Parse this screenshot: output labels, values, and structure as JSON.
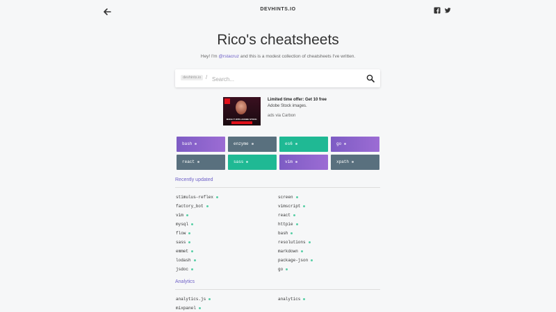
{
  "header": {
    "brand": "DEVHINTS.IO"
  },
  "hero": {
    "title": "Rico's cheatsheets",
    "intro_before": "Hey! I'm ",
    "intro_handle": "@rstacruz",
    "intro_after": " and this is a modest collection of cheatsheets I've written."
  },
  "search": {
    "site_chip": "devhints.io",
    "slash": "/",
    "placeholder": "Search..."
  },
  "ad": {
    "title": "Limited time offer: Get 10 free",
    "body": "Adobe Stock images.",
    "credit": "ads via Carbon",
    "image_caption": "MAKE IT WITH ADOBE STOCK."
  },
  "tiles": [
    {
      "label": "bash",
      "color": "purple"
    },
    {
      "label": "enzyme",
      "color": "slate"
    },
    {
      "label": "es6",
      "color": "teal"
    },
    {
      "label": "go",
      "color": "purple"
    },
    {
      "label": "react",
      "color": "slate"
    },
    {
      "label": "sass",
      "color": "teal"
    },
    {
      "label": "vim",
      "color": "purple"
    },
    {
      "label": "xpath",
      "color": "slate"
    }
  ],
  "recently_updated": {
    "heading": "Recently updated",
    "left": [
      "stimulus-reflex",
      "factory_bot",
      "vim",
      "mysql",
      "flow",
      "sass",
      "emmet",
      "lodash",
      "jsdoc"
    ],
    "right": [
      "screen",
      "vimscript",
      "react",
      "httpie",
      "bash",
      "resolutions",
      "markdown",
      "package-json",
      "go"
    ]
  },
  "analytics": {
    "heading": "Analytics",
    "left": [
      "analytics.js",
      "mixpanel"
    ],
    "right": [
      "analytics"
    ]
  },
  "colors": {
    "accent": "#6d5fc7",
    "purple": "#8a63cc",
    "slate": "#59707e",
    "teal": "#1fb994",
    "dot": "#58cfa6"
  }
}
